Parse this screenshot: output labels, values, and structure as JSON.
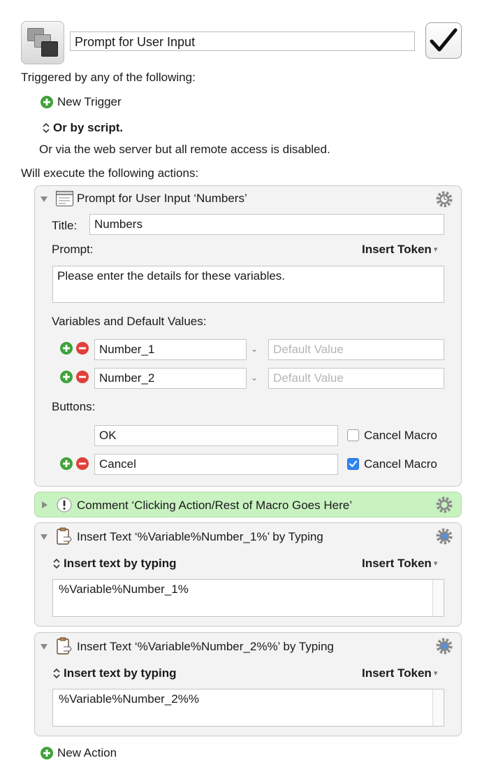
{
  "macro": {
    "name": "Prompt for User Input",
    "triggered_label": "Triggered by any of the following:",
    "new_trigger": "New Trigger",
    "or_by_script": "Or by script.",
    "web_server_note": "Or via the web server but all remote access is disabled.",
    "will_execute": "Will execute the following actions:",
    "new_action": "New Action"
  },
  "prompt_action": {
    "title": "Prompt for User Input ‘Numbers’",
    "title_label": "Title:",
    "title_value": "Numbers",
    "prompt_label": "Prompt:",
    "insert_token": "Insert Token",
    "prompt_text": "Please enter the details for these variables.",
    "vars_label": "Variables and Default Values:",
    "variables": [
      {
        "name": "Number_1",
        "default_placeholder": "Default Value"
      },
      {
        "name": "Number_2",
        "default_placeholder": "Default Value"
      }
    ],
    "buttons_label": "Buttons:",
    "buttons": [
      {
        "label": "OK",
        "cancel_macro": "Cancel Macro",
        "checked": false
      },
      {
        "label": "Cancel",
        "cancel_macro": "Cancel Macro",
        "checked": true
      }
    ]
  },
  "comment_action": {
    "title": "Comment ‘Clicking Action/Rest of Macro Goes Here’"
  },
  "insert_actions": [
    {
      "title": "Insert Text ‘%Variable%Number_1%’ by Typing",
      "mode": "Insert text by typing",
      "insert_token": "Insert Token",
      "text": "%Variable%Number_1%"
    },
    {
      "title": "Insert Text ‘%Variable%Number_2%%’ by Typing",
      "mode": "Insert text by typing",
      "insert_token": "Insert Token",
      "text": "%Variable%Number_2%%"
    }
  ],
  "colors": {
    "green_add": "#3fa33a",
    "red_remove": "#e0403a",
    "comment_bg": "#c9f2c1",
    "checkbox_blue": "#2e84f0"
  }
}
